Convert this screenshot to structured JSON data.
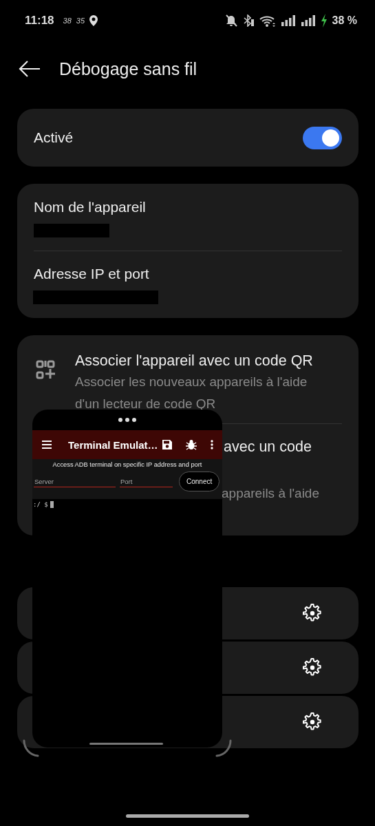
{
  "status_bar": {
    "time": "11:18",
    "notifications": [
      "38",
      "35"
    ],
    "battery": "38 %",
    "charging": true
  },
  "header": {
    "title": "Débogage sans fil"
  },
  "main_switch": {
    "label": "Activé",
    "on": true
  },
  "device_info": [
    {
      "label": "Nom de l'appareil",
      "value_redacted": true
    },
    {
      "label": "Adresse IP et port",
      "value_redacted": true
    }
  ],
  "pairing": [
    {
      "kind": "qr",
      "title": "Associer l'appareil avec un code QR",
      "subtitle": "Associer les nouveaux appareils à l'aide\nd'un lecteur de code QR"
    },
    {
      "kind": "covered",
      "title": "avec un code",
      "subtitle": "appareils à l'aide"
    }
  ],
  "paired_devices": [
    {
      "kind": "settings"
    },
    {
      "kind": "settings"
    },
    {
      "kind": "settings"
    }
  ],
  "floating_window": {
    "app_title": "Terminal Emulat…",
    "hint": "Access ADB terminal on specific IP address and port",
    "fields": [
      {
        "placeholder": "Server"
      },
      {
        "placeholder": "Port"
      }
    ],
    "button": "Connect",
    "prompt": ":/ $"
  }
}
